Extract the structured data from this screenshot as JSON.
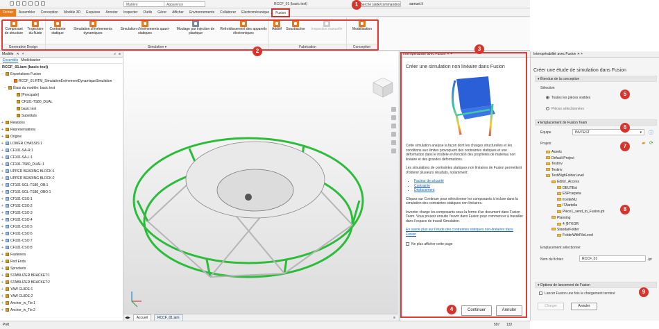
{
  "titlebar": {
    "material": "Matière",
    "appearance": "Apparence",
    "window_title": "RCCF_01 (basic test)",
    "search": "Recherche (aide/commandes)...",
    "user": "samuel.li"
  },
  "menu": [
    "Fichier",
    "Assembler",
    "Conception",
    "Modèle 3D",
    "Esquisse",
    "Annoter",
    "Inspecter",
    "Outils",
    "Gérer",
    "Afficher",
    "Environnements",
    "Collaborer",
    "Electromécanique",
    "Fusion"
  ],
  "ribbon": {
    "groups": [
      {
        "label": "Generative Design",
        "tools": [
          "Composant de structure",
          "Trajectoire du fluide"
        ]
      },
      {
        "label": "Simulation ▾",
        "tools": [
          "Contrainte statique",
          "Simulation d'événements dynamiques",
          "Simulation d'événements quasi-statiques",
          "Moulage par injection de plastique",
          "Refroidissement des appareils électroniques"
        ]
      },
      {
        "label": "Fabrication",
        "tools": [
          "Additif",
          "Soustractive",
          "Inspection manuelle"
        ]
      },
      {
        "label": "Conception",
        "tools": [
          "Modélisation"
        ]
      }
    ]
  },
  "model_panel": {
    "tab": "Modèle",
    "subtabs": [
      "Ensemble",
      "Modélisation"
    ],
    "root": "RCCF_01.iam (basic test)",
    "items": [
      "Exportations Fusion",
      "RCCF_01:RTM_SimulationÉvénementDynamiqueSimulation",
      "États du modèle: basic test",
      "[Principale]",
      "CF101-TS80_DUAL",
      "basic test",
      "Substituts",
      "Relations",
      "Représentations",
      "Origine",
      "LOWER CHASSIS:1",
      "CF101-SA-R:1",
      "CF101-SA-L:1",
      "CF101-TS80_DUAL:1",
      "UPPER BEARING BLOCK:1",
      "UPPER BEARING BLOCK:2",
      "CF101-SGL-TS80_OB:1",
      "CF101-SGL-TS80_OBO:1",
      "CF101-CSO:1",
      "CF101-CSO:2",
      "CF101-CSO:3",
      "CF101-CSO:4",
      "CF101-CSO:5",
      "CF101-CSO:6",
      "CF101-CSO:7",
      "CF101-CSO:8",
      "Fasteners",
      "Rod Ends",
      "Sprockets",
      "STABILIZER BRACKET:1",
      "STABILIZER BRACKET:2",
      "YAW GUIDE:1",
      "YAW GUIDE:2",
      "Anchor_w_Tie:1",
      "Anchor_w_Tie:2"
    ]
  },
  "viewport_tabs": [
    "Accueil",
    "RCCF_01.iam"
  ],
  "status": {
    "left": "Prêt",
    "n1": "597",
    "n2": "132"
  },
  "interop": {
    "title": "Interopérabilité avec Fusion",
    "heading": "Créer une simulation non linéaire dans Fusion",
    "p1": "Cette simulation analyse la façon dont les charges structurelles et les conditions aux limites provoquent des contraintes statiques et une déformation dans le modèle en fonction des propriétés de matériau non linéaire et des grandes déformations.",
    "p2": "Les simulations de contraintes statiques non linéaires de Fusion permettent d'obtenir plusieurs résultats, notamment:",
    "bullets": [
      "Facteur de sécurité",
      "Contrainte",
      "Déplacement"
    ],
    "p3": "Cliquez sur Continuer pour sélectionner les composants à inclure dans la simulation des contraintes statiques non linéaires.",
    "p4": "Inventor charge les composants sous la forme d'un document dans Fusion Team. Vous pouvez ensuite l'ouvrir dans Fusion pour commencer à travailler dans l'espace de travail Simulation.",
    "link": "En savoir plus sur l'étude des contraintes statiques non-linéaires dans Fusion",
    "checkbox": "Ne plus afficher cette page",
    "continue": "Continuer",
    "cancel": "Annuler"
  },
  "right_panel": {
    "title": "Interopérabilité avec Fusion",
    "heading": "Créer une étude de simulation dans Fusion",
    "sec1": "Étendue de la conception",
    "selection_label": "Sélection",
    "opt1": "Toutes les pièces visibles",
    "opt2": "Pièces sélectionnées",
    "sec2": "Emplacement de Fusion Team",
    "team_label": "Équipe",
    "team_value": "INVTEST",
    "projects_label": "Projets",
    "folders": [
      "Assets",
      "Default Project",
      "TestInv",
      "Testinv",
      "TestWighFolderLevel",
      "Editor_Access",
      "DEUTEst",
      "ESPcarpeta",
      "fromENU",
      "ITAartella",
      "Pièce1_send_to_Fusion.ipt",
      "Planning",
      "4 多TKOR",
      "StandarFolder",
      "FolderWithFileLevel"
    ],
    "selected_location": "Emplacement sélectionné:",
    "filename_label": "Nom du fichier:",
    "filename_value": "RCCF_01",
    "ext": ".ipt",
    "sec3": "Options de lancement de Fusion",
    "launch_opt": "Lancer Fusion une fois le chargement terminé",
    "load": "Charger",
    "cancel": "Annuler"
  },
  "badges": [
    "1",
    "2",
    "3",
    "4",
    "5",
    "6",
    "7",
    "8",
    "9"
  ]
}
